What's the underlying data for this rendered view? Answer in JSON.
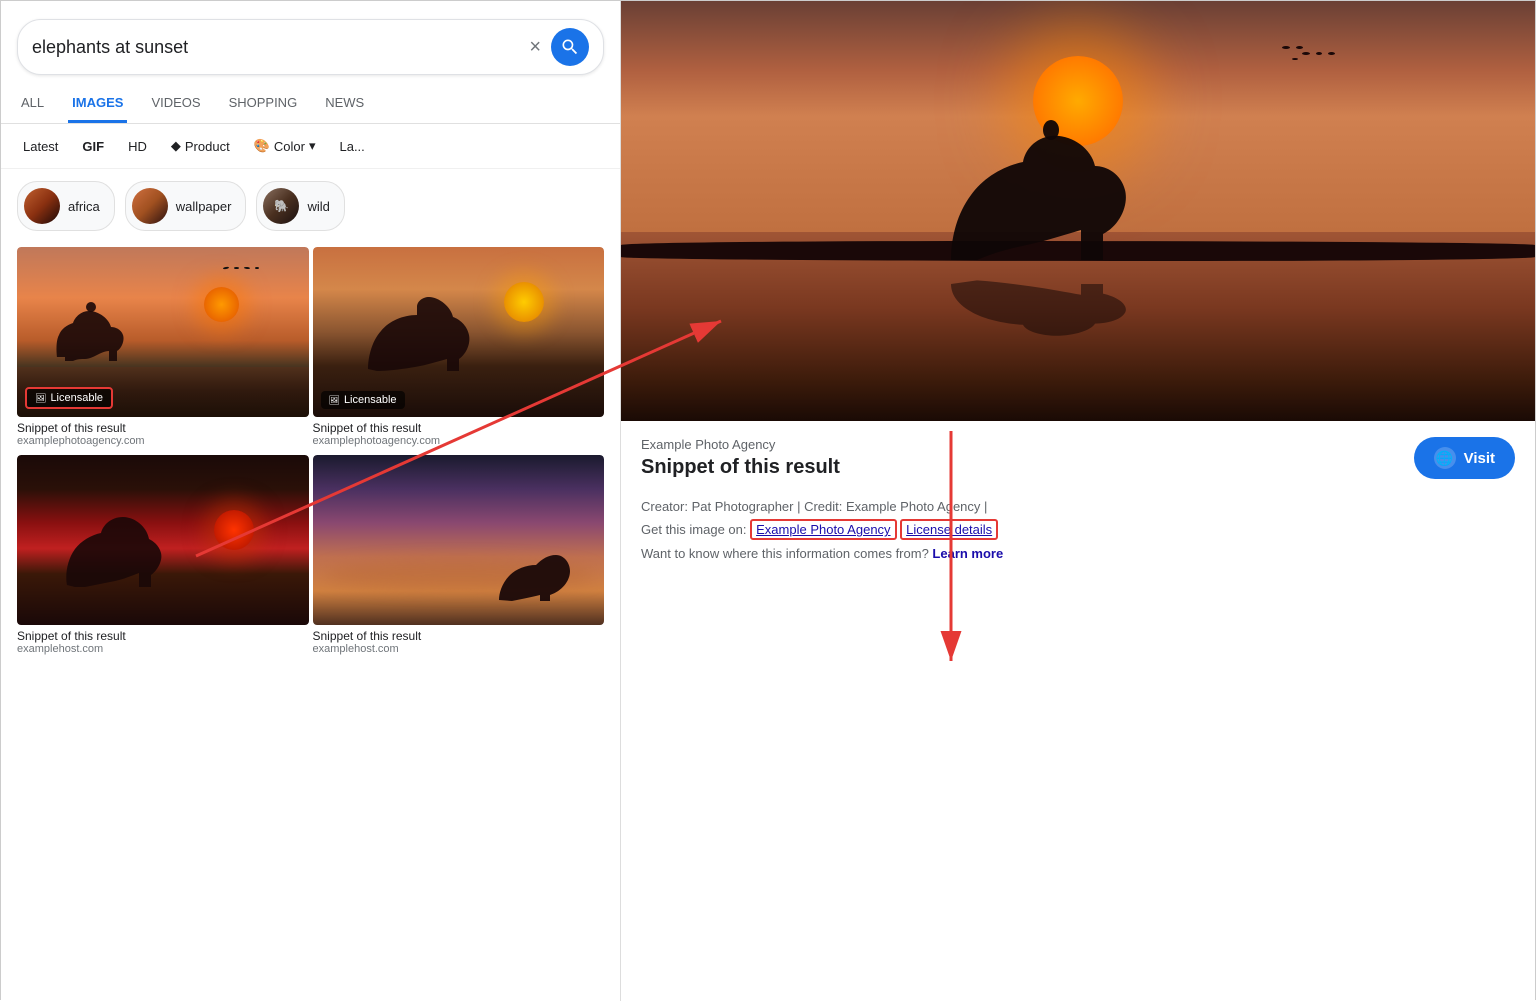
{
  "search": {
    "query": "elephants at sunset",
    "clear_button": "×",
    "placeholder": "elephants at sunset"
  },
  "tabs": [
    {
      "label": "ALL",
      "active": false
    },
    {
      "label": "IMAGES",
      "active": true
    },
    {
      "label": "VIDEOS",
      "active": false
    },
    {
      "label": "SHOPPING",
      "active": false
    },
    {
      "label": "NEWS",
      "active": false
    }
  ],
  "filters": [
    {
      "label": "Latest",
      "bold": false
    },
    {
      "label": "GIF",
      "bold": true
    },
    {
      "label": "HD",
      "bold": false
    },
    {
      "label": "Product",
      "bold": false,
      "has_icon": true
    },
    {
      "label": "Color",
      "bold": false,
      "has_dropdown": true
    },
    {
      "label": "La...",
      "bold": false
    }
  ],
  "chips": [
    {
      "label": "africa",
      "key": "chip-africa"
    },
    {
      "label": "wallpaper",
      "key": "chip-wallpaper"
    },
    {
      "label": "wild",
      "key": "chip-wild"
    }
  ],
  "grid_items": [
    {
      "id": "img1",
      "licensable": true,
      "badge_label": "Licensable",
      "caption": "Snippet of this result",
      "source": "examplephotoagency.com",
      "highlighted": true
    },
    {
      "id": "img2",
      "licensable": true,
      "badge_label": "Licensable",
      "caption": "Snippet of this result",
      "source": "examplephotoagency.com",
      "highlighted": false
    },
    {
      "id": "img3",
      "licensable": false,
      "caption": "Snippet of this result",
      "source": "examplehost.com",
      "highlighted": false
    },
    {
      "id": "img4",
      "licensable": false,
      "caption": "Snippet of this result",
      "source": "examplehost.com",
      "highlighted": false
    }
  ],
  "viewer": {
    "close_icon": "×",
    "share_icon": "⤴",
    "bookmark_icon": "⬜",
    "agency": "Example Photo Agency",
    "title": "Snippet of this result",
    "visit_button": "Visit",
    "meta_line1_prefix": "Creator: Pat Photographer | Credit: ",
    "meta_line1_agency": "Example Photo Agency",
    "meta_line1_suffix": " |",
    "meta_line2_prefix": "Get this image on: ",
    "meta_link1": "Example Photo Agency",
    "meta_link2": "License details",
    "meta_line3_prefix": "Want to know where this information comes from? ",
    "meta_link3": "Learn more"
  }
}
